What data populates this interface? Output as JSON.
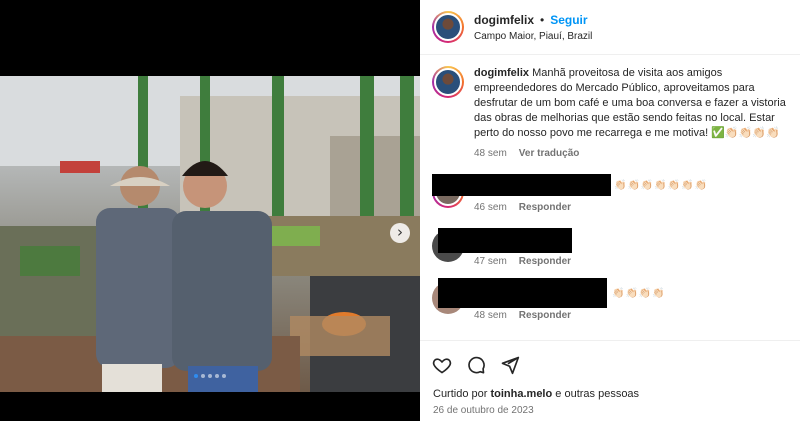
{
  "post": {
    "username": "dogimfelix",
    "separator": "•",
    "follow_label": "Seguir",
    "location": "Campo Maior, Piauí, Brazil"
  },
  "caption": {
    "username": "dogimfelix",
    "text": "Manhã proveitosa de visita aos amigos empreendedores do Mercado Público, aproveitamos para desfrutar de um bom café e uma boa conversa e fazer a vistoria das obras de melhorias que estão sendo feitas no local. Estar perto do nosso povo me recarrega e me motiva! ✅👏🏻👏🏻👏🏻👏🏻",
    "time": "48 sem",
    "translate_label": "Ver tradução"
  },
  "comments": [
    {
      "emojis": "👏🏻👏🏻👏🏻👏🏻👏🏻👏🏻👏🏻",
      "time": "46 sem",
      "reply_label": "Responder"
    },
    {
      "emojis": "",
      "time": "47 sem",
      "reply_label": "Responder"
    },
    {
      "emojis": "👏🏻👏🏻👏🏻👏🏻",
      "time": "48 sem",
      "reply_label": "Responder"
    }
  ],
  "footer": {
    "liked_prefix": "Curtido por",
    "liked_user": "toinha.melo",
    "liked_suffix": "e outras pessoas",
    "date": "26 de outubro de 2023"
  },
  "carousel": {
    "total": 5,
    "active_index": 0
  },
  "icons": [
    "like-icon",
    "comment-icon",
    "share-icon",
    "next-arrow-icon"
  ],
  "colors": {
    "accent": "#0095f6",
    "muted": "#737373",
    "text": "#262626",
    "active_dot": "#2f8cf0"
  }
}
